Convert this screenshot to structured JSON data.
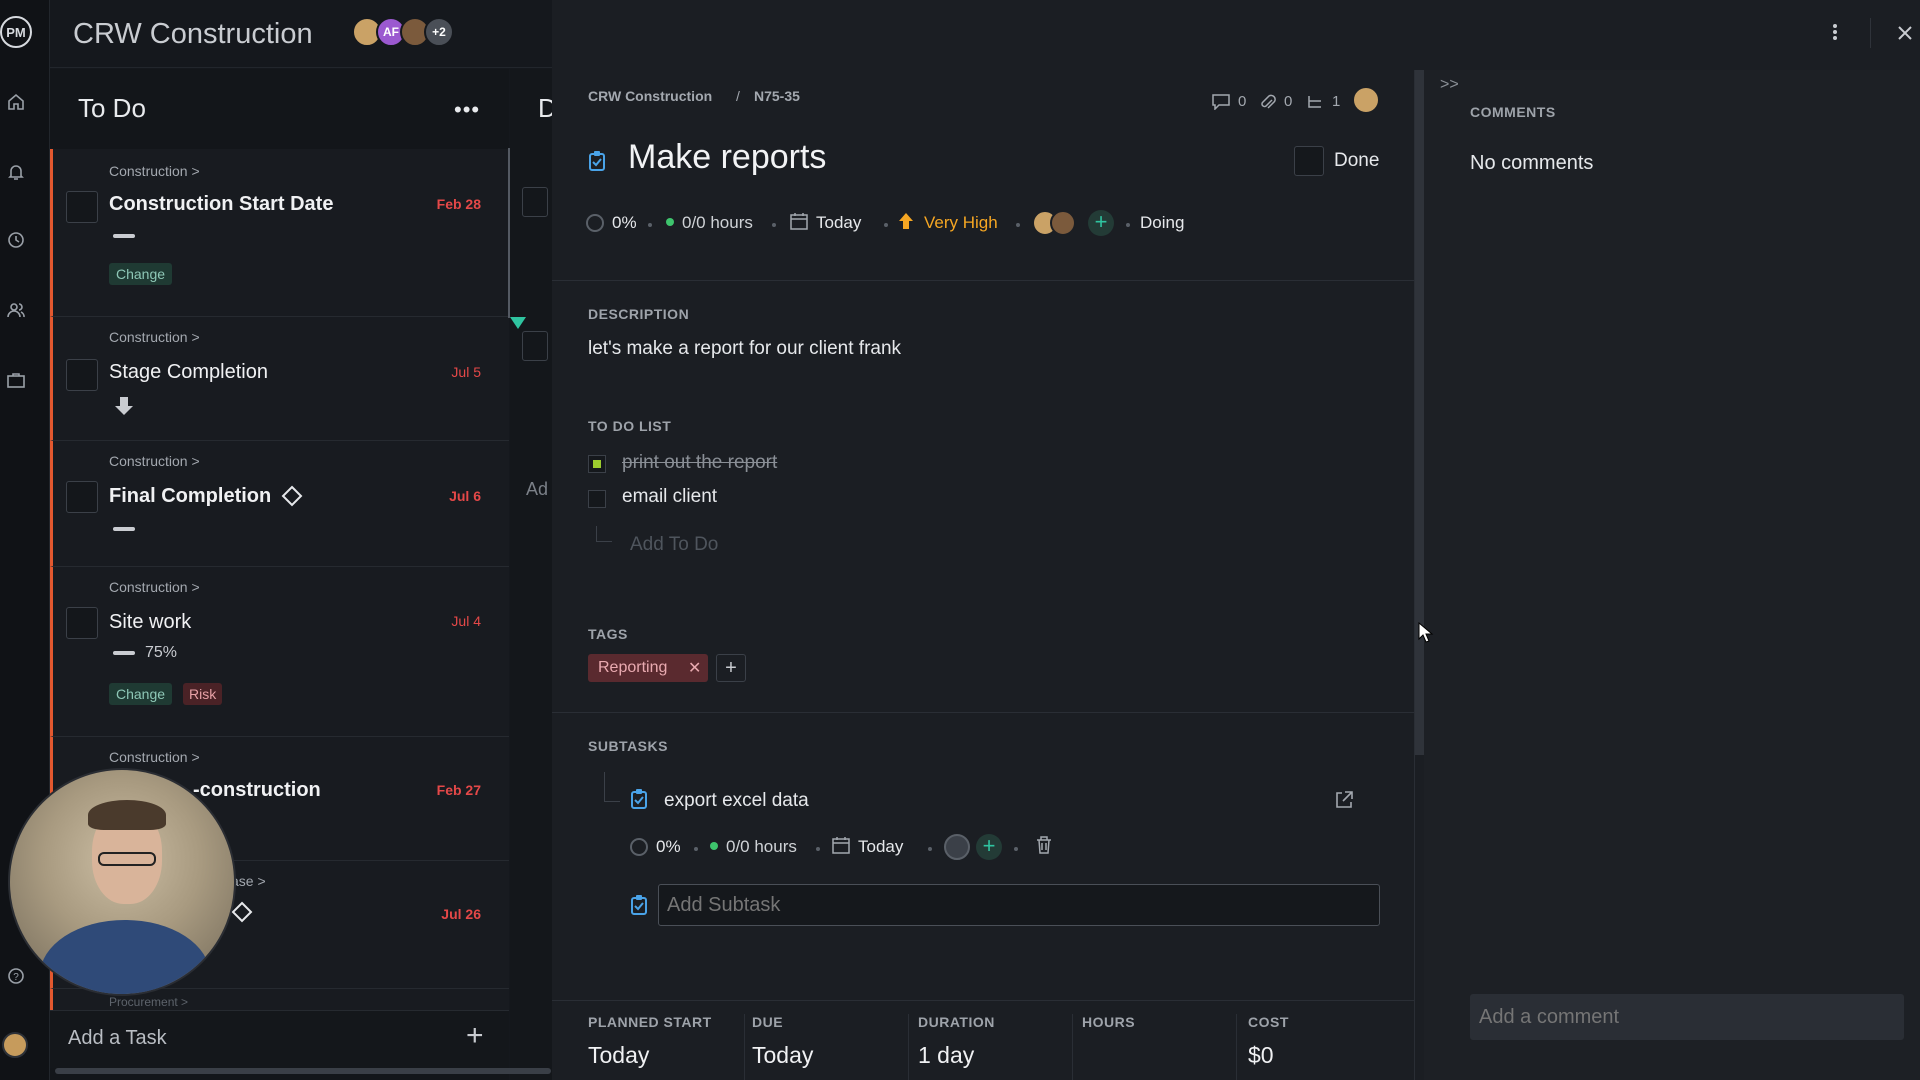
{
  "project": {
    "title": "CRW Construction",
    "avatars": [
      "AF",
      "+2"
    ]
  },
  "rail": {
    "logo": "PM"
  },
  "column": {
    "title": "To Do",
    "menu": "•••",
    "next_col_letter": "D",
    "next_col_add": "Ad",
    "cards": [
      {
        "crumb": "Construction >",
        "title": "Construction Start Date",
        "date": "Feb 28",
        "tags": [
          "Change"
        ]
      },
      {
        "crumb": "Construction >",
        "title": "Stage Completion",
        "date": "Jul 5"
      },
      {
        "crumb": "Construction >",
        "title": "Final Completion",
        "date": "Jul 6"
      },
      {
        "crumb": "Construction >",
        "title": "Site work",
        "date": "Jul 4",
        "percent": "75%",
        "tags": [
          "Change",
          "Risk"
        ]
      },
      {
        "crumb": "Construction >",
        "title": "-construction",
        "date": "Feb 27"
      },
      {
        "crumb": "ase >",
        "date": "Jul 26"
      },
      {
        "crumb": "Procurement >"
      }
    ],
    "add_task": "Add a Task",
    "add_plus": "+"
  },
  "detail": {
    "breadcrumb": {
      "project": "CRW Construction",
      "sep": "/",
      "id": "N75-35"
    },
    "counts": {
      "comments": "0",
      "attachments": "0",
      "subtasks": "1"
    },
    "title": "Make reports",
    "done_label": "Done",
    "meta": {
      "percent": "0%",
      "hours": "0/0 hours",
      "date": "Today",
      "priority": "Very High",
      "status": "Doing"
    },
    "description": {
      "label": "DESCRIPTION",
      "text": "let's make a report for our client frank"
    },
    "todo": {
      "label": "TO DO LIST",
      "items": [
        {
          "text": "print out the report",
          "done": true
        },
        {
          "text": "email client",
          "done": false
        }
      ],
      "add_placeholder": "Add To Do"
    },
    "tags": {
      "label": "TAGS",
      "items": [
        "Reporting"
      ],
      "add": "+"
    },
    "subtasks": {
      "label": "SUBTASKS",
      "items": [
        {
          "title": "export excel data",
          "percent": "0%",
          "hours": "0/0 hours",
          "date": "Today"
        }
      ],
      "add_placeholder": "Add Subtask"
    },
    "footer": {
      "planned_start": {
        "label": "PLANNED START",
        "value": "Today"
      },
      "due": {
        "label": "DUE",
        "value": "Today"
      },
      "duration": {
        "label": "DURATION",
        "value": "1 day"
      },
      "hours": {
        "label": "HOURS",
        "value": ""
      },
      "cost": {
        "label": "COST",
        "value": "$0"
      }
    },
    "comments": {
      "label": "COMMENTS",
      "empty": "No comments",
      "placeholder": "Add a comment"
    }
  },
  "colors": {
    "accent_orange": "#e2582f",
    "date_red": "#e44848",
    "priority": "#f5a623",
    "tag_reporting": "#5a2a2f",
    "check_green": "#9ccc2e",
    "plus_green": "#2fc4a0",
    "subtask_icon": "#4aa3e8"
  },
  "icons": [
    "home-icon",
    "bell-icon",
    "clock-icon",
    "people-icon",
    "briefcase-icon",
    "help-icon",
    "kebab-icon",
    "close-icon",
    "expand-icon",
    "comment-icon",
    "paperclip-icon",
    "subtask-icon",
    "calendar-icon",
    "priority-arrow-icon",
    "trash-icon",
    "open-external-icon",
    "task-clipboard-icon"
  ]
}
